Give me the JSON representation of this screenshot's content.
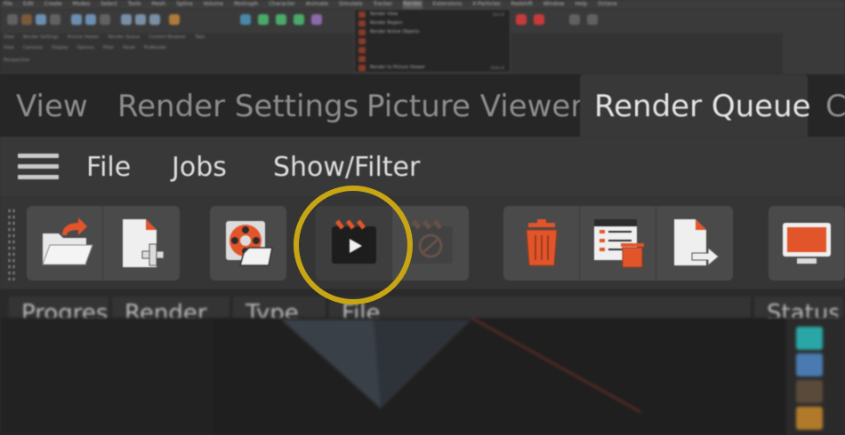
{
  "top_menu": {
    "items": [
      "File",
      "Edit",
      "Create",
      "Modes",
      "Select",
      "Tools",
      "Mesh",
      "Spline",
      "Volume",
      "MoGraph",
      "Character",
      "Animate",
      "Simulate",
      "Tracker",
      "Render",
      "Extensions",
      "X-Particles",
      "Redshift",
      "Window",
      "Help",
      "Octane"
    ],
    "active_index": 14
  },
  "top_submenu_row1": [
    "View",
    "Render Settings",
    "Picture Viewer",
    "Render Queue",
    "Content Browser",
    "Take"
  ],
  "top_submenu_row2": [
    "View",
    "Cameras",
    "Display",
    "Options",
    "Filter",
    "Panel",
    "ProRender"
  ],
  "top_submenu_row3": [
    "Perspective"
  ],
  "render_popup": {
    "items": [
      {
        "label": "Render View",
        "shortcut": "Ctrl+R"
      },
      {
        "label": "Render Region",
        "shortcut": ""
      },
      {
        "label": "Render Active Objects",
        "shortcut": ""
      },
      {
        "label": "",
        "shortcut": ""
      },
      {
        "label": "",
        "shortcut": ""
      },
      {
        "label": "",
        "shortcut": ""
      },
      {
        "label": "Render to Picture Viewer",
        "shortcut": "Shift+R"
      }
    ]
  },
  "tabs": {
    "view": "View",
    "render_settings": "Render Settings",
    "picture_viewer": "Picture Viewer",
    "render_queue": "Render Queue",
    "overflow": "C"
  },
  "menu": {
    "file": "File",
    "jobs": "Jobs",
    "show_filter": "Show/Filter"
  },
  "toolbar": {
    "groups": [
      [
        "open-project-icon",
        "new-job-icon"
      ],
      [
        "render-settings-icon"
      ],
      [
        "start-render-icon",
        "stop-render-icon"
      ],
      [
        "delete-job-icon",
        "delete-all-jobs-icon",
        "export-job-icon"
      ],
      [
        "monitor-icon"
      ]
    ]
  },
  "list_columns": [
    "Progress",
    "Render",
    "Type",
    "File",
    "Status"
  ],
  "colors": {
    "accent_orange": "#e2552a",
    "highlight_ring": "#c8a512",
    "panel_bg": "#383838",
    "tab_bg": "#262626"
  }
}
